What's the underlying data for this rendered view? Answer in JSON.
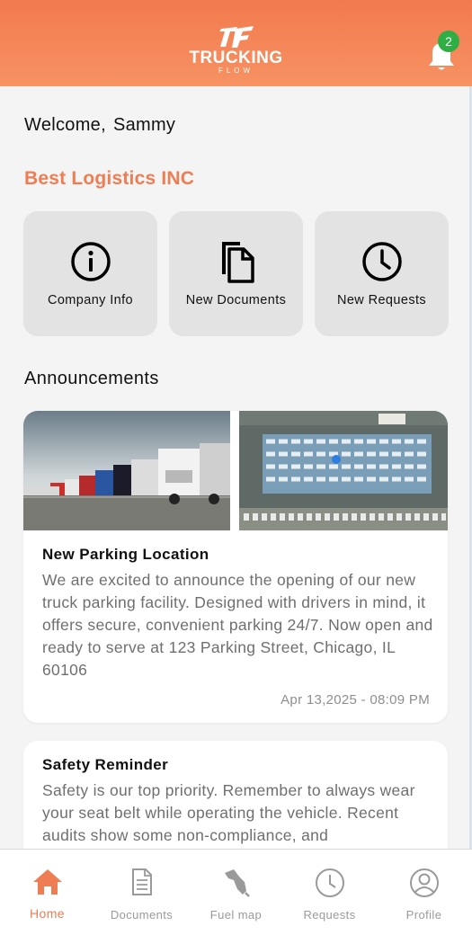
{
  "app": {
    "logo_word": "TRUCKING",
    "logo_sub": "FLOW",
    "brand_color": "#f27a4e",
    "notification_count": "2"
  },
  "welcome": {
    "greeting": "Welcome,",
    "name": "Sammy"
  },
  "company": {
    "name": "Best Logistics INC"
  },
  "quick_actions": [
    {
      "label": "Company Info",
      "icon": "info-circle-icon"
    },
    {
      "label": "New Documents",
      "icon": "documents-icon"
    },
    {
      "label": "New Requests",
      "icon": "clock-icon"
    }
  ],
  "announcements": {
    "title": "Announcements",
    "items": [
      {
        "title": "New Parking Location",
        "body": "We are excited to announce the opening of our new truck parking facility. Designed with drivers in mind, it offers secure, convenient parking 24/7. Now open and ready to serve at 123 Parking Street, Chicago, IL 60106",
        "date": "Apr 13,2025 - 08:09 PM"
      },
      {
        "title": "Safety Reminder",
        "body": "Safety is our top priority. Remember to always wear your seat belt while operating the vehicle. Recent audits show some non-compliance, and"
      }
    ]
  },
  "tabs": [
    {
      "label": "Home",
      "icon": "home-icon",
      "active": true
    },
    {
      "label": "Documents",
      "icon": "document-icon"
    },
    {
      "label": "Fuel map",
      "icon": "fuel-nozzle-icon"
    },
    {
      "label": "Requests",
      "icon": "clock-icon"
    },
    {
      "label": "Profile",
      "icon": "profile-icon"
    }
  ]
}
